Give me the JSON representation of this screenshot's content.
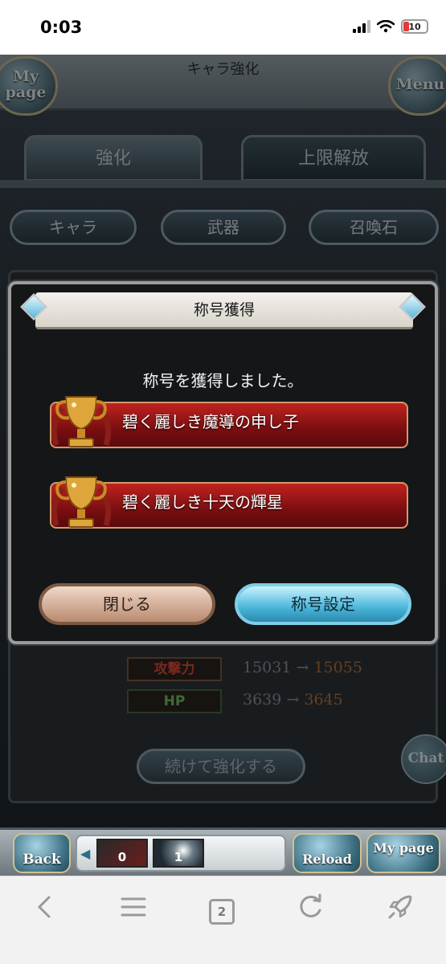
{
  "status_bar": {
    "time": "0:03",
    "battery_level": "10"
  },
  "game": {
    "header": {
      "title": "キャラ強化",
      "mypage_label": "My page",
      "menu_label": "Menu"
    },
    "tabs": [
      {
        "label": "強化"
      },
      {
        "label": "上限解放"
      }
    ],
    "filters": [
      {
        "label": "キャラ"
      },
      {
        "label": "武器"
      },
      {
        "label": "召喚石"
      }
    ],
    "stats": {
      "attack": {
        "label": "攻撃力",
        "before": "15031",
        "arrow": "→",
        "after": "15055"
      },
      "hp": {
        "label": "HP",
        "before": "3639",
        "arrow": "→",
        "after": "3645"
      }
    },
    "continue_label": "続けて強化する",
    "chat_label": "Chat",
    "nav": {
      "back_label": "Back",
      "reload_label": "Reload",
      "mypage_label": "My page",
      "slot1_count": "0",
      "slot2_count": "1"
    }
  },
  "dialog": {
    "title": "称号獲得",
    "message": "称号を獲得しました。",
    "titles": [
      {
        "name": "碧く麗しき魔導の申し子"
      },
      {
        "name": "碧く麗しき十天の輝星"
      }
    ],
    "close_label": "閉じる",
    "settings_label": "称号設定"
  },
  "browser": {
    "tab_count": "2"
  },
  "colors": {
    "title_bar_red": "#9e1a18",
    "settings_blue": "#4ab6da",
    "close_beige": "#d9b8a4",
    "atk_red": "#e04a3a",
    "hp_green": "#6fc25b"
  }
}
